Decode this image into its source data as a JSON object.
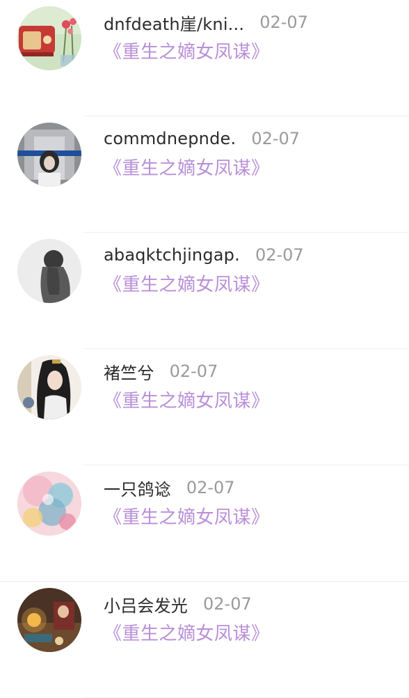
{
  "items": [
    {
      "name": "dnfdeath崖/kni...",
      "date": "02-07",
      "book": "《重生之嫡女凤谋》"
    },
    {
      "name": "commdnepnde.",
      "date": "02-07",
      "book": "《重生之嫡女凤谋》"
    },
    {
      "name": "abaqktchjingap.",
      "date": "02-07",
      "book": "《重生之嫡女凤谋》"
    },
    {
      "name": "褚竺兮",
      "date": "02-07",
      "book": "《重生之嫡女凤谋》"
    },
    {
      "name": "一只鸽谂",
      "date": "02-07",
      "book": "《重生之嫡女凤谋》"
    },
    {
      "name": "小吕会发光",
      "date": "02-07",
      "book": "《重生之嫡女凤谋》"
    }
  ],
  "colors": {
    "name": "#2b2b2b",
    "date": "#9a9a9a",
    "book_title": "#b98fd8",
    "divider": "#f0f0f0"
  },
  "avatars": [
    "radio-flowers-avatar",
    "girl-portrait-avatar",
    "silhouette-avatar",
    "anime-character-avatar",
    "watercolor-art-avatar",
    "cozy-room-avatar"
  ]
}
